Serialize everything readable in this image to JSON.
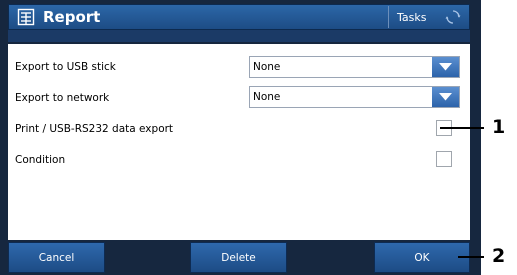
{
  "window": {
    "title": "Report",
    "tasks_label": "Tasks"
  },
  "fields": {
    "export_usb": {
      "label": "Export to USB stick",
      "value": "None"
    },
    "export_network": {
      "label": "Export to network",
      "value": "None"
    },
    "print_export": {
      "label": "Print / USB-RS232 data export",
      "checked": false
    },
    "condition": {
      "label": "Condition",
      "checked": false
    }
  },
  "footer": {
    "cancel": "Cancel",
    "delete": "Delete",
    "ok": "OK"
  },
  "callouts": {
    "one": "1",
    "two": "2"
  },
  "colors": {
    "device_bg": "#16273f",
    "button_blue": "#1d4c85",
    "dropdown_blue": "#2c63aa"
  },
  "icons": {
    "title": "report-icon",
    "tasks": "tasks-circular-arrows-icon",
    "dropdown": "chevron-down-icon"
  }
}
